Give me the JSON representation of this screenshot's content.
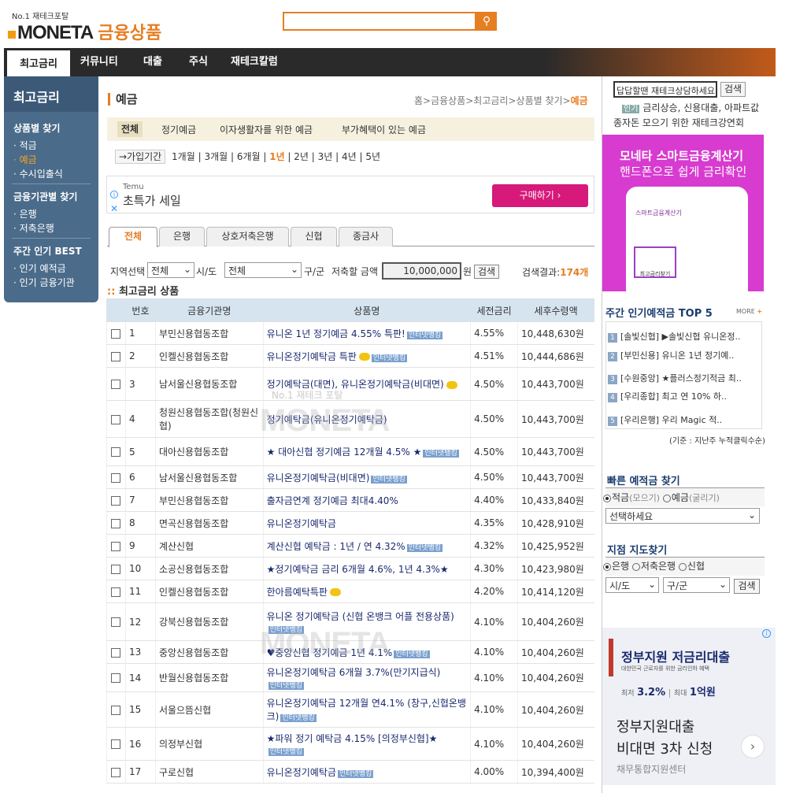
{
  "header": {
    "tagline": "No.1 재테크포탈",
    "logo": "MONETA",
    "logo_sub": "금융상품",
    "search_placeholder": ""
  },
  "nav": [
    "최고금리",
    "커뮤니티",
    "대출",
    "주식",
    "재테크칼럼"
  ],
  "left_sidebar": {
    "title": "최고금리",
    "section1": "상품별 찾기",
    "items1": [
      "· 적금",
      "· 예금",
      "· 수시입출식"
    ],
    "section2": "금융기관별 찾기",
    "items2": [
      "· 은행",
      "· 저축은행"
    ],
    "section3": "주간 인기 BEST",
    "items3": [
      "· 인기 예적금",
      "· 인기 금융기관"
    ]
  },
  "page": {
    "title": "예금",
    "breadcrumb": "홈>금융상품>최고금리>상품별 찾기>",
    "breadcrumb_current": "예금",
    "subtabs": [
      "전체",
      "정기예금",
      "이자생활자를 위한 예금",
      "부가혜택이 있는 예금"
    ],
    "period_label": "→가입기간",
    "periods": [
      "1개월",
      "3개월",
      "6개월",
      "1년",
      "2년",
      "3년",
      "4년",
      "5년"
    ]
  },
  "ad": {
    "brand": "Temu",
    "text": "초특가 세일",
    "button": "구매하기"
  },
  "tabs": [
    "전체",
    "은행",
    "상호저축은행",
    "신협",
    "종금사"
  ],
  "filter": {
    "region_label": "지역선택",
    "sido_value": "전체",
    "sido_label": "시/도",
    "gugun_value": "전체",
    "gugun_label": "구/군",
    "amount_label": "저축할 금액",
    "amount_value": "10,000,000",
    "amount_unit": "원",
    "search_button": "검색",
    "result_label": "검색결과:",
    "result_count": "174개"
  },
  "section_title": "최고금리 상품",
  "section_prefix": "::",
  "table": {
    "headers": [
      "번호",
      "금융기관명",
      "상품명",
      "세전금리",
      "세후수령액"
    ],
    "rows": [
      {
        "no": "1",
        "bank": "부민신용협동조합",
        "product": "유니온 1년 정기예금 4.55% 특판!",
        "badge": "인터넷뱅킹",
        "coin": false,
        "rate": "4.55%",
        "amount": "10,448,630원"
      },
      {
        "no": "2",
        "bank": "인켈신용협동조합",
        "product": "유니온정기예탁금 특판",
        "badge": "인터넷뱅킹",
        "coin": true,
        "rate": "4.51%",
        "amount": "10,444,686원"
      },
      {
        "no": "3",
        "bank": "남서울신용협동조합",
        "product": "정기예탁금(대면), 유니온정기예탁금(비대면)",
        "badge": "",
        "coin": true,
        "rate": "4.50%",
        "amount": "10,443,700원"
      },
      {
        "no": "4",
        "bank": "청원신용협동조합(청원신협)",
        "product": "정기예탁금(유니온정기예탁금)",
        "badge": "",
        "coin": false,
        "rate": "4.50%",
        "amount": "10,443,700원"
      },
      {
        "no": "5",
        "bank": "대아신용협동조합",
        "product": "★ 대아신협 정기예금 12개월 4.5% ★",
        "badge": "인터넷뱅킹",
        "coin": false,
        "rate": "4.50%",
        "amount": "10,443,700원"
      },
      {
        "no": "6",
        "bank": "남서울신용협동조합",
        "product": "유니온정기예탁금(비대면)",
        "badge": "인터넷뱅킹",
        "coin": false,
        "rate": "4.50%",
        "amount": "10,443,700원"
      },
      {
        "no": "7",
        "bank": "부민신용협동조합",
        "product": "출자금연계 정기예금 최대4.40%",
        "badge": "",
        "coin": false,
        "rate": "4.40%",
        "amount": "10,433,840원"
      },
      {
        "no": "8",
        "bank": "면곡신용협동조합",
        "product": "유니온정기예탁금",
        "badge": "",
        "coin": false,
        "rate": "4.35%",
        "amount": "10,428,910원"
      },
      {
        "no": "9",
        "bank": "계산신협",
        "product": "계산신협 예탁금 : 1년 / 연 4.32%",
        "badge": "인터넷뱅킹",
        "coin": false,
        "rate": "4.32%",
        "amount": "10,425,952원"
      },
      {
        "no": "10",
        "bank": "소공신용협동조합",
        "product": "★정기예탁금 금리 6개월 4.6%, 1년 4.3%★",
        "badge": "",
        "coin": false,
        "rate": "4.30%",
        "amount": "10,423,980원"
      },
      {
        "no": "11",
        "bank": "인켈신용협동조합",
        "product": "한아름예탁특판",
        "badge": "",
        "coin": true,
        "rate": "4.20%",
        "amount": "10,414,120원"
      },
      {
        "no": "12",
        "bank": "강북신용협동조합",
        "product": "유니온 정기예탁금 (신협 온뱅크 어플 전용상품)",
        "badge": "인터넷뱅킹",
        "coin": false,
        "rate": "4.10%",
        "amount": "10,404,260원"
      },
      {
        "no": "13",
        "bank": "중앙신용협동조합",
        "product": "♥중앙신협 정기예금 1년 4.1%",
        "badge": "인터넷뱅킹",
        "coin": false,
        "rate": "4.10%",
        "amount": "10,404,260원"
      },
      {
        "no": "14",
        "bank": "반월신용협동조합",
        "product": "유니온정기예탁금 6개월 3.7%(만기지급식)",
        "badge": "인터넷뱅킹",
        "coin": false,
        "rate": "4.10%",
        "amount": "10,404,260원"
      },
      {
        "no": "15",
        "bank": "서울으뜸신협",
        "product": "유니온정기예탁금 12개월 연4.1% (창구,신협온뱅크)",
        "badge": "인터넷뱅킹",
        "coin": false,
        "rate": "4.10%",
        "amount": "10,404,260원"
      },
      {
        "no": "16",
        "bank": "의정부신협",
        "product": "★파워 정기 예탁금 4.15% [의정부신협]★",
        "badge": "인터넷뱅킹",
        "coin": false,
        "rate": "4.10%",
        "amount": "10,404,260원"
      },
      {
        "no": "17",
        "bank": "구로신협",
        "product": "유니온정기예탁금",
        "badge": "인터넷뱅킹",
        "coin": false,
        "rate": "4.00%",
        "amount": "10,394,400원"
      }
    ]
  },
  "watermark": {
    "tag": "No.1 재테크 포탈",
    "logo": "MONETA"
  },
  "right": {
    "search_value": "답답할땐 재테크상담하세요",
    "search_button": "검색",
    "tag_label": "인기",
    "tags": "금리상승, 신용대출, 아파트값",
    "tags2": "종자돈 모으기 위한 재테크강연회",
    "banner_title": "모네타 스마트금융계산기",
    "banner_sub": "핸드폰으로 쉽게 금리확인",
    "banner_app": "스마트금융계산기",
    "banner_btn": "최고금리찾기",
    "top5_title": "주간 인기예적금 TOP 5",
    "top5_more": "MORE",
    "top5": [
      "[솔빛신협] ▶솔빛신협 유니온정..",
      "[부민신용] 유니온 1년 정기예..",
      "[수원중앙] ★플러스정기적금 최..",
      "[우리종합] 최고 연 10% 하..",
      "[우리은행] 우리 Magic 적.."
    ],
    "top5_note": "(기준 : 지난주 누적클릭수순)",
    "fast_title": "빠른 예적금 찾기",
    "fast_radio1": "적금",
    "fast_radio1_sub": "(모으기)",
    "fast_radio2": "예금",
    "fast_radio2_sub": "(굴리기)",
    "fast_select": "선택하세요",
    "branch_title": "지점 지도찾기",
    "branch_radios": [
      "은행",
      "저축은행",
      "신협"
    ],
    "branch_sido": "시/도",
    "branch_gugun": "구/군",
    "branch_btn": "검색",
    "ad_title": "정부지원 저금리대출",
    "ad_sub": "대한민국 근로자를 위한 금리인하 혜택",
    "ad_rate_low_label": "최저",
    "ad_rate_low": "3.2%",
    "ad_rate_max_label": "최대",
    "ad_rate_max": "1억원",
    "ad_line1": "정부지원대출",
    "ad_line2": "비대면 3차 신청",
    "ad_footer": "채무통합지원센터"
  },
  "colors": {
    "accent": "#e67e22",
    "nav_bg": "#2a2a2a",
    "sidebar": "#4b6b8a",
    "table_head": "#d6e4f0"
  }
}
